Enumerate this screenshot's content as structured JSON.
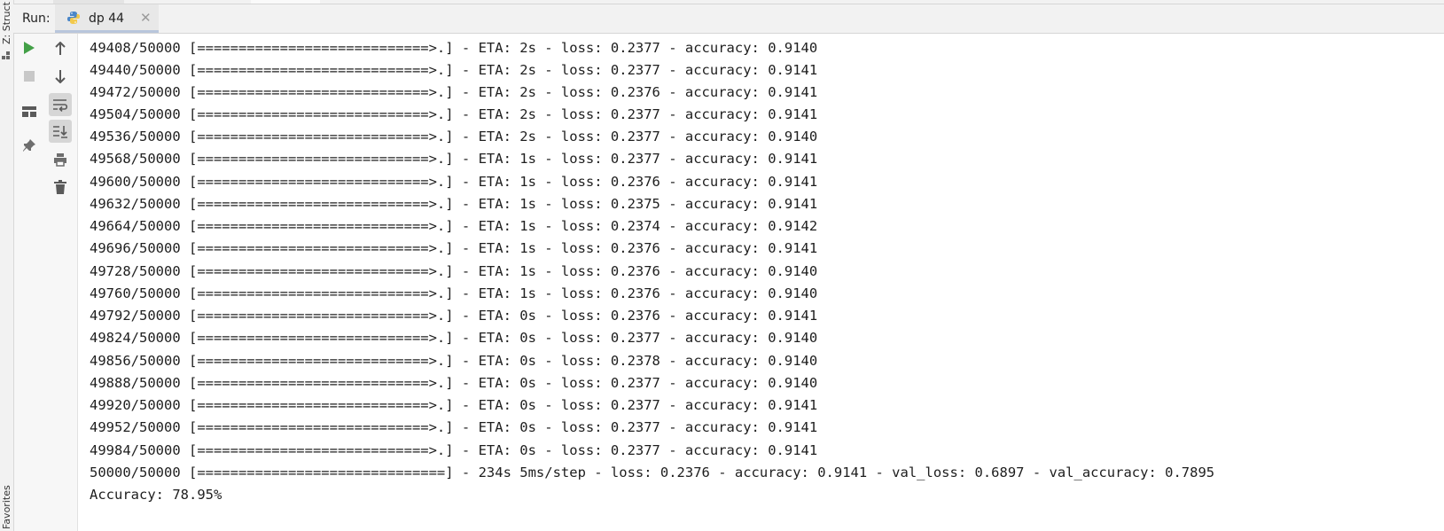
{
  "side": {
    "structure_label": "Z: Structure",
    "favorites_label": "Favorites"
  },
  "run_panel": {
    "label": "Run:",
    "tab_label": "dp 44",
    "close_glyph": "✕"
  },
  "toolbar": {
    "buttons": [
      "run-icon",
      "stop-icon",
      "up-arrow-icon",
      "down-arrow-icon",
      "layout-icon",
      "soft-wrap-icon",
      "scroll-to-end-icon",
      "pin-icon",
      "print-icon",
      "trash-icon"
    ]
  },
  "colors": {
    "run_green": "#43a047",
    "icon_gray": "#6e6e6e",
    "tab_underline": "#b8c6dc"
  },
  "console": {
    "lines": [
      "49408/50000 [============================>.] - ETA: 2s - loss: 0.2377 - accuracy: 0.9140",
      "49440/50000 [============================>.] - ETA: 2s - loss: 0.2377 - accuracy: 0.9141",
      "49472/50000 [============================>.] - ETA: 2s - loss: 0.2376 - accuracy: 0.9141",
      "49504/50000 [============================>.] - ETA: 2s - loss: 0.2377 - accuracy: 0.9141",
      "49536/50000 [============================>.] - ETA: 2s - loss: 0.2377 - accuracy: 0.9140",
      "49568/50000 [============================>.] - ETA: 1s - loss: 0.2377 - accuracy: 0.9141",
      "49600/50000 [============================>.] - ETA: 1s - loss: 0.2376 - accuracy: 0.9141",
      "49632/50000 [============================>.] - ETA: 1s - loss: 0.2375 - accuracy: 0.9141",
      "49664/50000 [============================>.] - ETA: 1s - loss: 0.2374 - accuracy: 0.9142",
      "49696/50000 [============================>.] - ETA: 1s - loss: 0.2376 - accuracy: 0.9141",
      "49728/50000 [============================>.] - ETA: 1s - loss: 0.2376 - accuracy: 0.9140",
      "49760/50000 [============================>.] - ETA: 1s - loss: 0.2376 - accuracy: 0.9140",
      "49792/50000 [============================>.] - ETA: 0s - loss: 0.2376 - accuracy: 0.9141",
      "49824/50000 [============================>.] - ETA: 0s - loss: 0.2377 - accuracy: 0.9140",
      "49856/50000 [============================>.] - ETA: 0s - loss: 0.2378 - accuracy: 0.9140",
      "49888/50000 [============================>.] - ETA: 0s - loss: 0.2377 - accuracy: 0.9140",
      "49920/50000 [============================>.] - ETA: 0s - loss: 0.2377 - accuracy: 0.9141",
      "49952/50000 [============================>.] - ETA: 0s - loss: 0.2377 - accuracy: 0.9141",
      "49984/50000 [============================>.] - ETA: 0s - loss: 0.2377 - accuracy: 0.9141",
      "50000/50000 [==============================] - 234s 5ms/step - loss: 0.2376 - accuracy: 0.9141 - val_loss: 0.6897 - val_accuracy: 0.7895",
      "Accuracy: 78.95%"
    ]
  }
}
